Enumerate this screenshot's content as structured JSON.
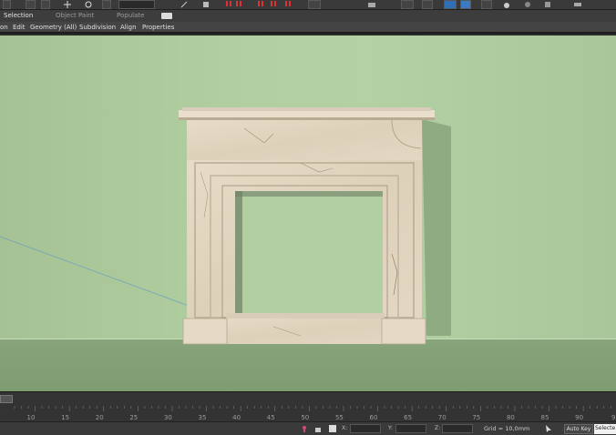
{
  "ribbon": {
    "tabs": [
      "Selection",
      "Object Paint",
      "Populate"
    ],
    "active_tab": "Selection"
  },
  "menu": {
    "items": [
      "on",
      "Edit",
      "Geometry (All)",
      "Subdivision",
      "Align",
      "Properties"
    ]
  },
  "timeline": {
    "ticks": [
      "10",
      "15",
      "20",
      "25",
      "30",
      "35",
      "40",
      "45",
      "50",
      "55",
      "60",
      "65",
      "70",
      "75",
      "80",
      "85",
      "90",
      "9"
    ]
  },
  "status": {
    "x_label": "X:",
    "y_label": "Y:",
    "z_label": "Z:",
    "grid": "Grid = 10,0mm",
    "autokey": "Auto Key",
    "selection_set": "Selecte"
  },
  "colors": {
    "viewport_background": "#b1cfa1",
    "floor": "#85a177",
    "marble": "#e2d7c2",
    "ui_dark": "#3a3a3a"
  }
}
